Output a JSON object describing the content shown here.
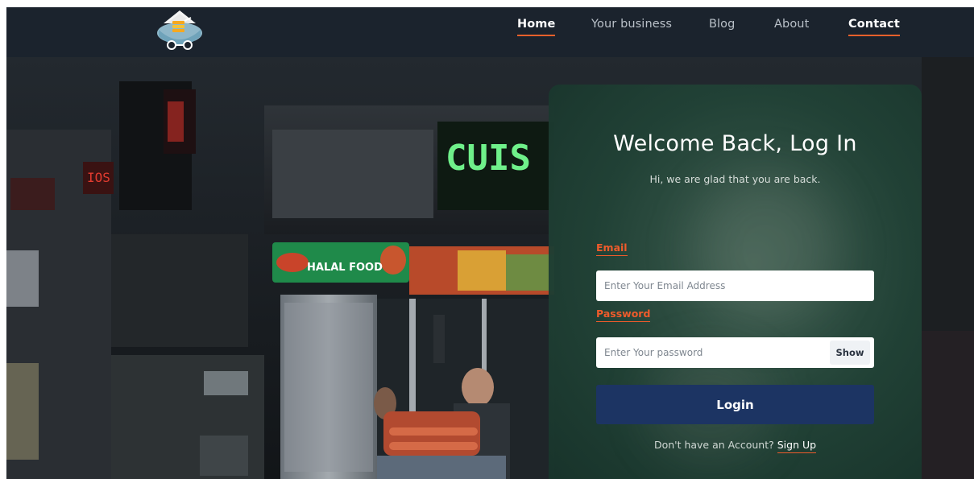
{
  "brand": {
    "logo_icon": "food-cart-logo-icon"
  },
  "nav": {
    "items": [
      {
        "label": "Home",
        "active": true
      },
      {
        "label": "Your business",
        "active": false
      },
      {
        "label": "Blog",
        "active": false
      },
      {
        "label": "About",
        "active": false
      },
      {
        "label": "Contact",
        "active": true
      }
    ]
  },
  "login": {
    "title": "Welcome Back, Log In",
    "subtitle": "Hi, we are glad that you are back.",
    "email_label": "Email",
    "email_placeholder": "Enter Your Email Address",
    "email_value": "",
    "password_label": "Password",
    "password_placeholder": "Enter Your password",
    "password_value": "",
    "show_label": "Show",
    "login_label": "Login",
    "signup_prompt": "Don't have an Account?",
    "signup_link": "Sign Up"
  },
  "colors": {
    "accent": "#ef5b2b",
    "header_bg": "#1b232d",
    "card_bg": "#214236",
    "login_button": "#1c3463"
  }
}
